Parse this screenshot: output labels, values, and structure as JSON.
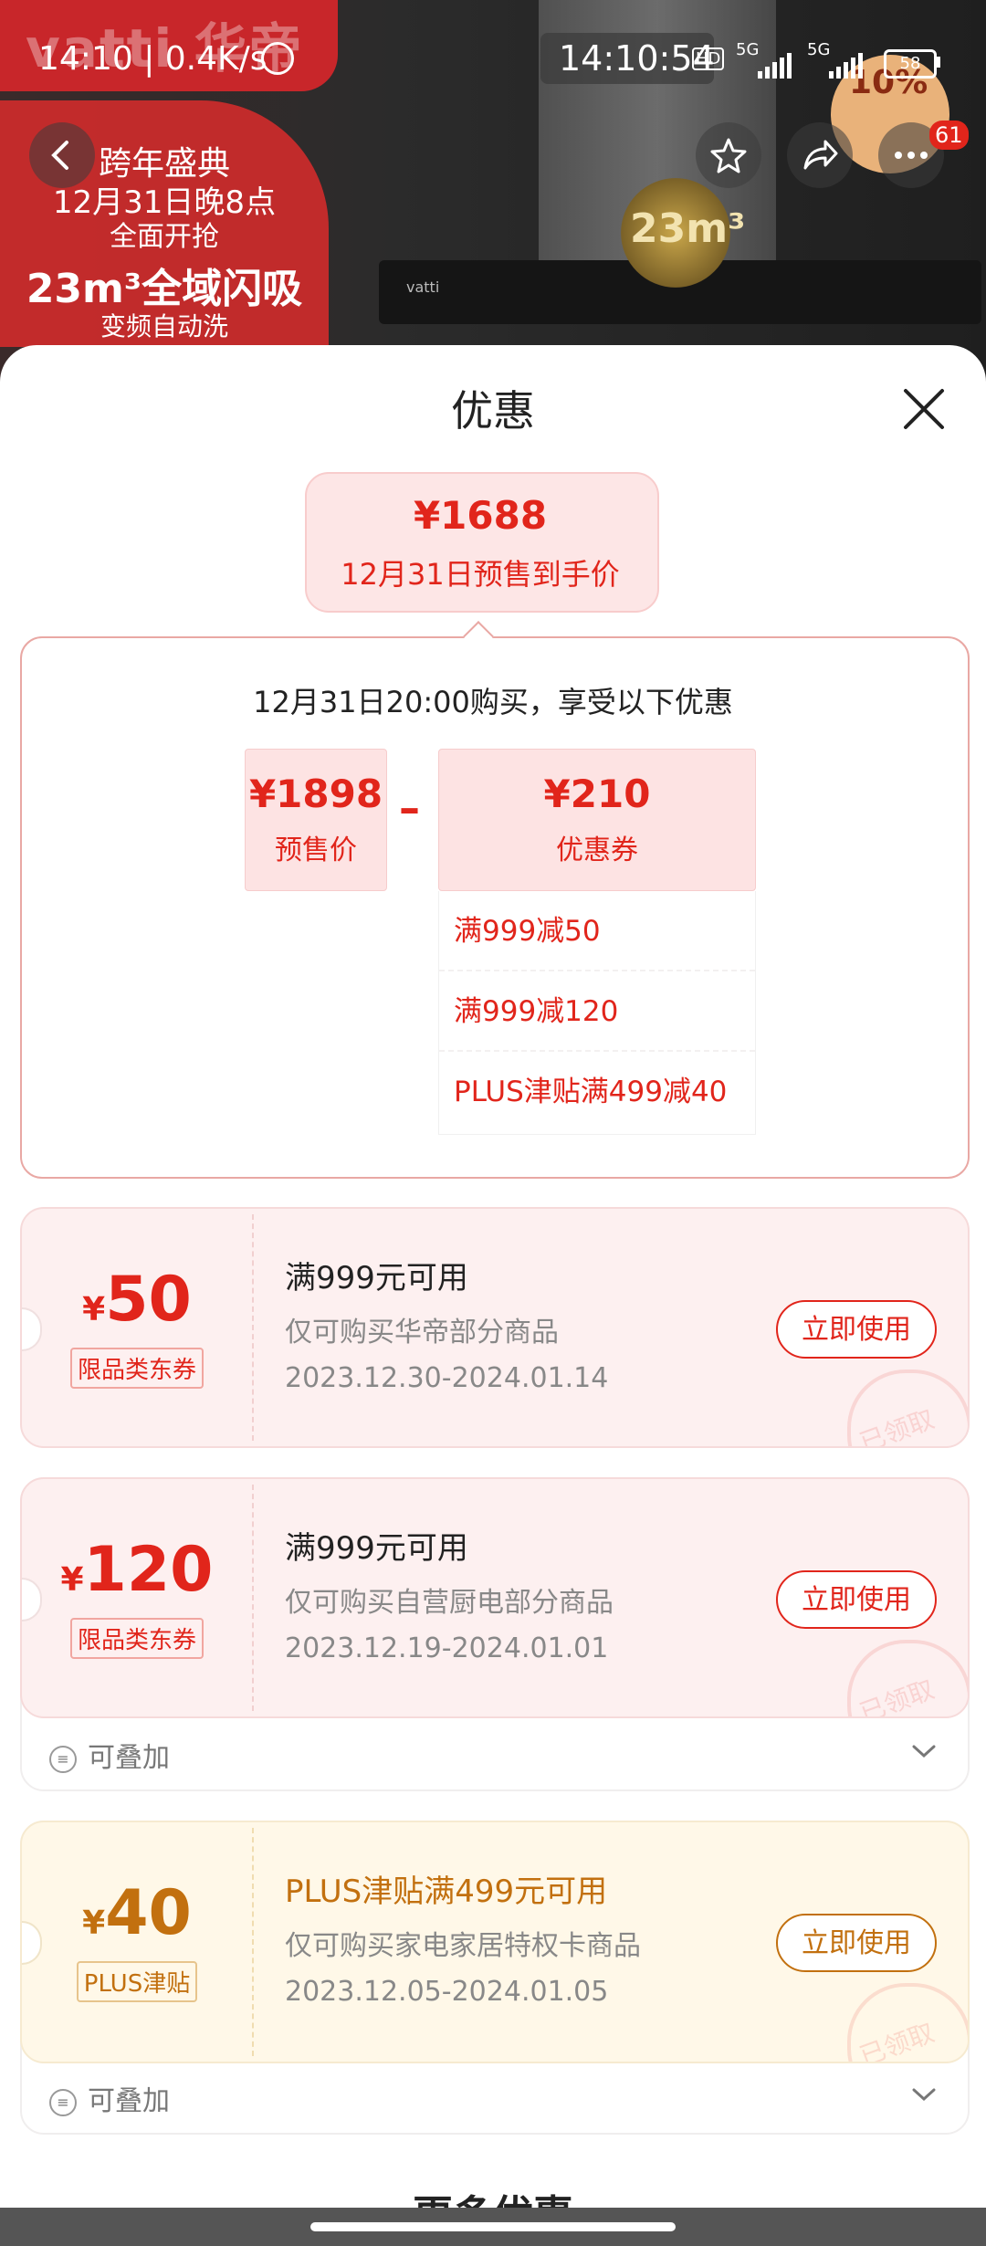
{
  "status_bar": {
    "time_left": "14:10 | 0.4K/s",
    "time_center": "14:10:54",
    "hd": "HD",
    "net_1": "5G",
    "net_2": "5G",
    "battery": "58"
  },
  "background": {
    "brand": "vatti 华帝",
    "promo": [
      "跨年盛典",
      "12月31日晚8点",
      "全面开抢",
      "23m³全域闪吸",
      "变频自动洗"
    ],
    "product_brand": "vatti",
    "badge": "23m³",
    "sale": "10%"
  },
  "nav": {
    "badge_count": "61"
  },
  "sheet": {
    "title": "优惠",
    "final_price": "¥1688",
    "final_label": "12月31日预售到手价",
    "calc_head": "12月31日20:00购买，享受以下优惠",
    "presale_value": "¥1898",
    "presale_label": "预售价",
    "coupon_value": "¥210",
    "coupon_label": "优惠券",
    "coupons_breakdown": [
      "满999减50",
      "满999减120",
      "PLUS津贴满499减40"
    ]
  },
  "cards": [
    {
      "currency": "¥",
      "amount": "50",
      "tag": "限品类东券",
      "title": "满999元可用",
      "subtitle": "仅可购买华帝部分商品",
      "date": "2023.12.30-2024.01.14",
      "button": "立即使用",
      "stamp": "已领取"
    },
    {
      "currency": "¥",
      "amount": "120",
      "tag": "限品类东券",
      "title": "满999元可用",
      "subtitle": "仅可购买自营厨电部分商品",
      "date": "2023.12.19-2024.01.01",
      "button": "立即使用",
      "stamp": "已领取",
      "stack": "可叠加"
    },
    {
      "currency": "¥",
      "amount": "40",
      "tag": "PLUS津贴",
      "title": "PLUS津贴满499元可用",
      "subtitle": "仅可购买家电家居特权卡商品",
      "date": "2023.12.05-2024.01.05",
      "button": "立即使用",
      "stamp": "已领取",
      "stack": "可叠加"
    }
  ],
  "more_title": "更多优惠",
  "colors": {
    "jd_red": "#e1251b",
    "plus_brown": "#c2700f"
  }
}
